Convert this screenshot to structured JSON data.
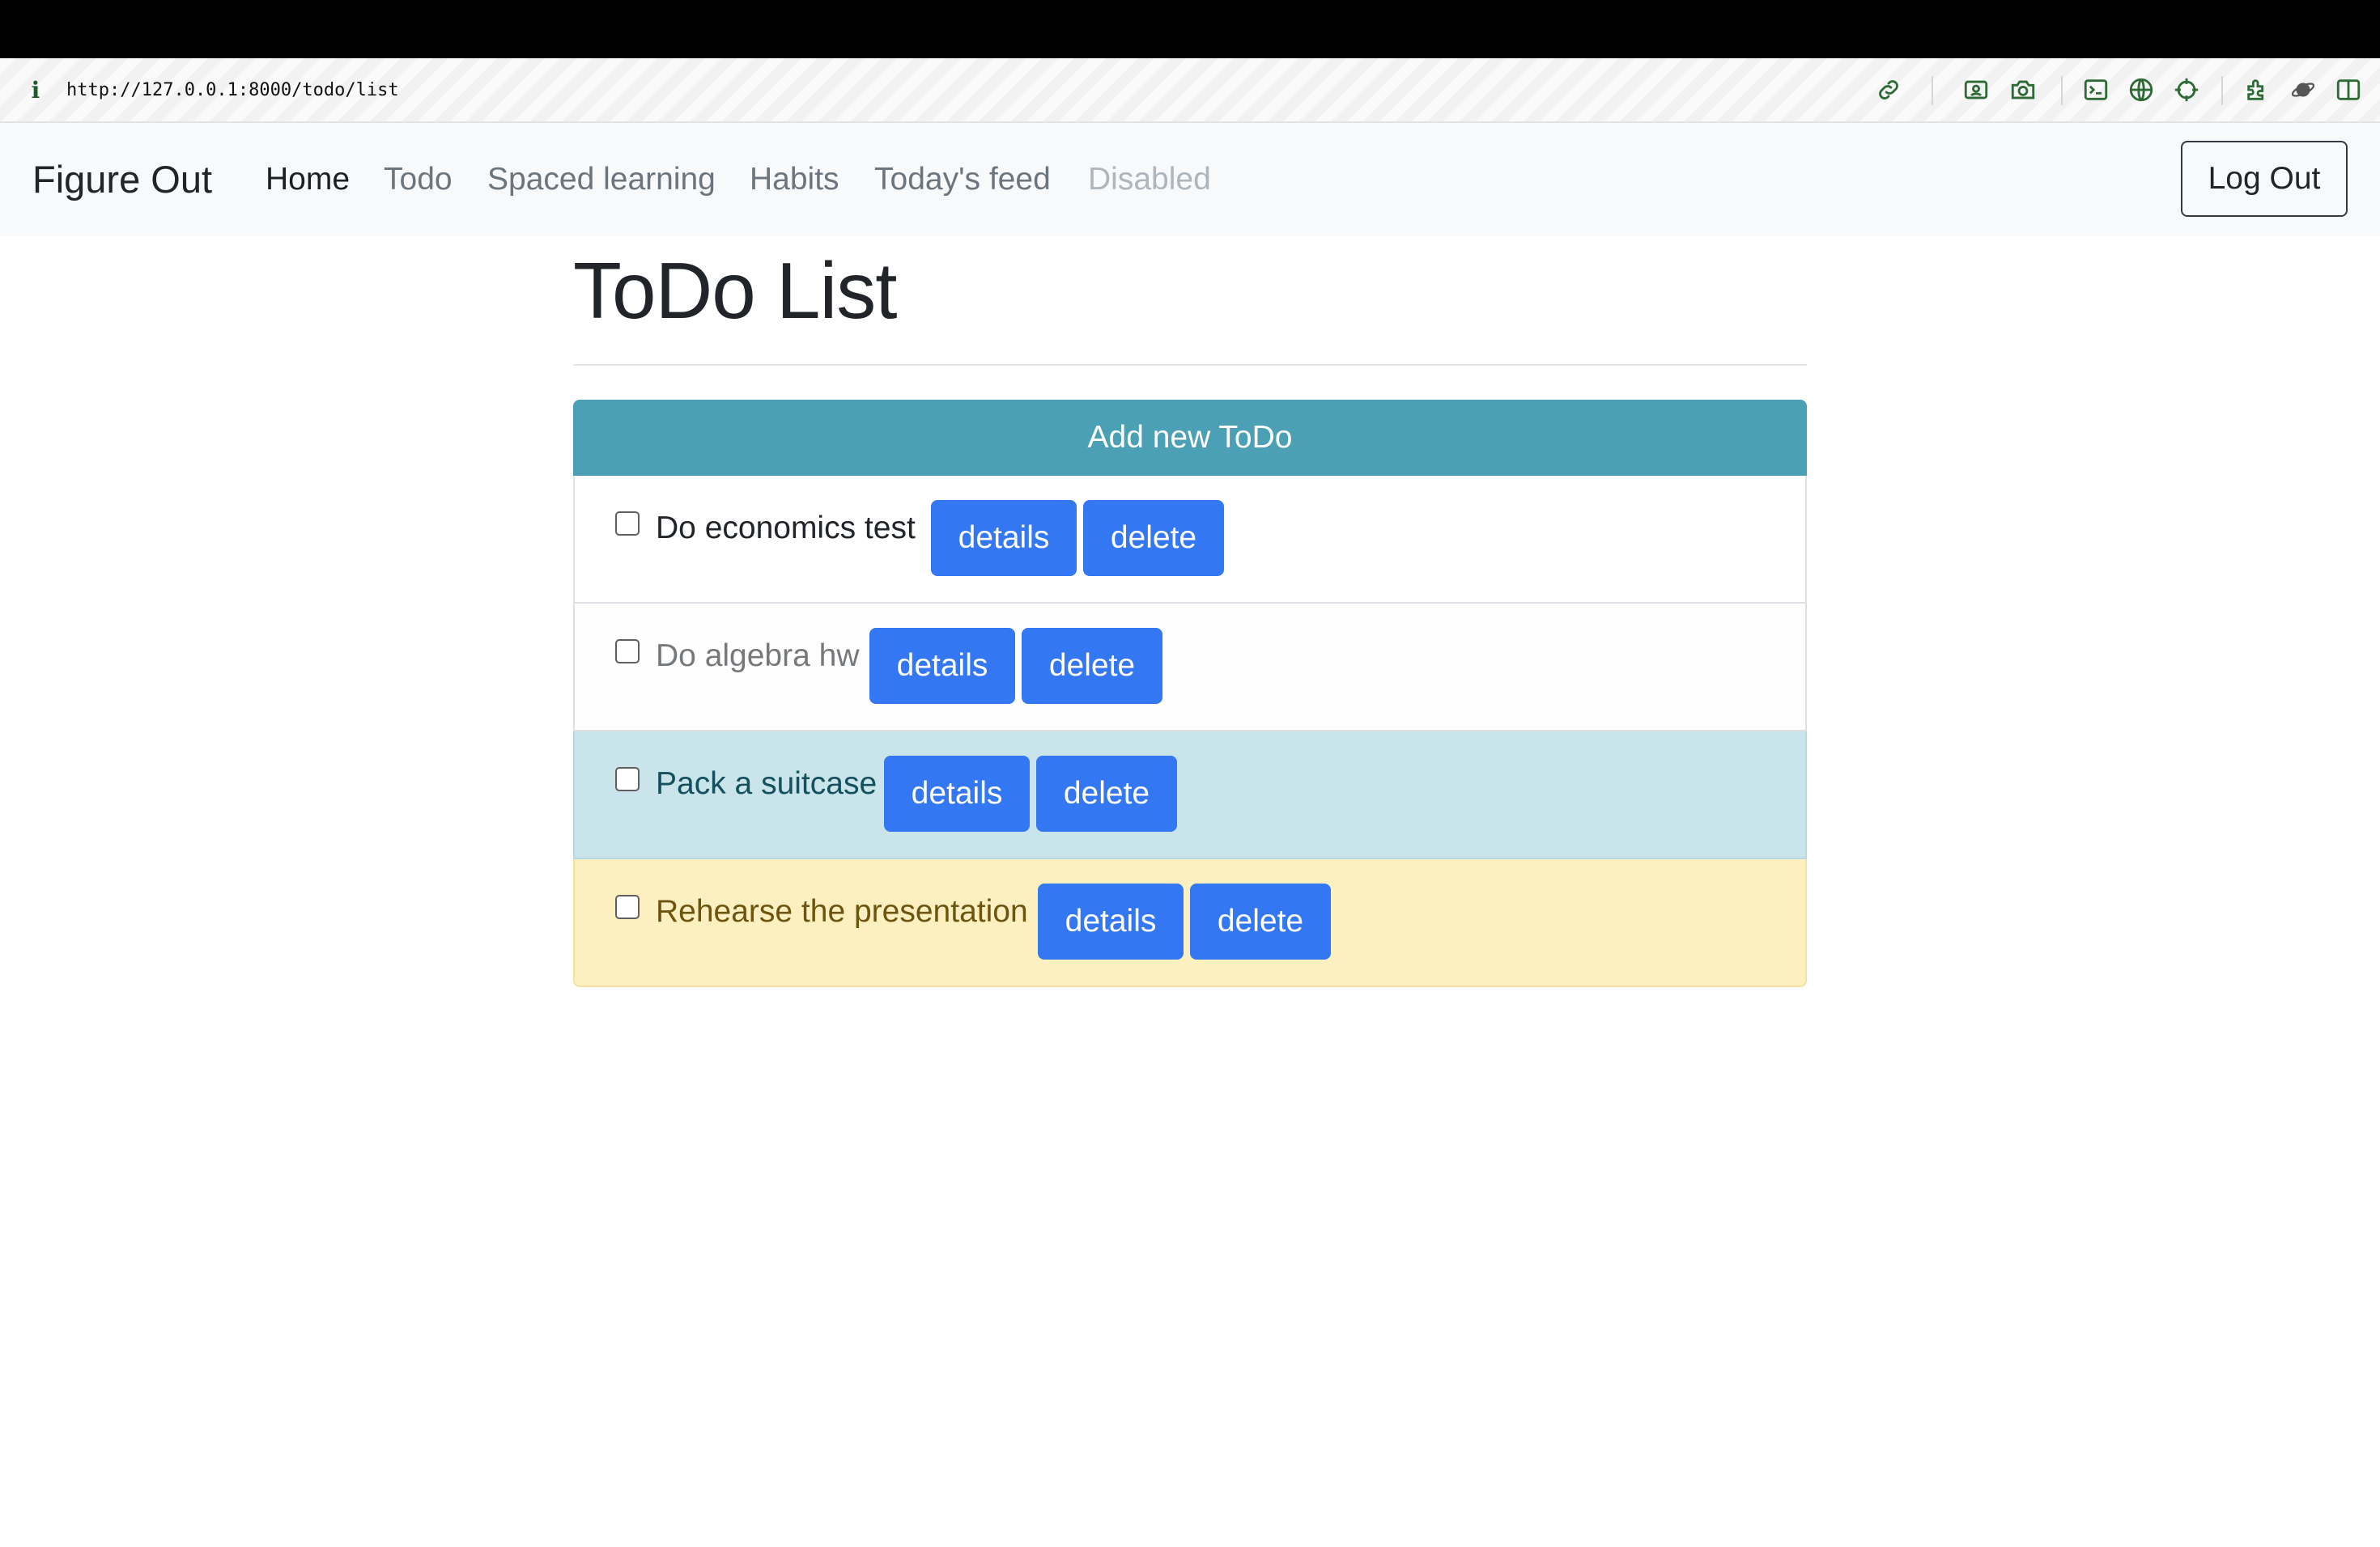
{
  "browser": {
    "info_icon": "i",
    "url": "http://127.0.0.1:8000/todo/list",
    "toolbar_icons": [
      "link-icon",
      "screenshot-icon",
      "camera-icon",
      "terminal-icon",
      "globe-icon",
      "crosshair-icon",
      "extensions-icon",
      "planet-icon",
      "split-view-icon"
    ]
  },
  "navbar": {
    "brand": "Figure Out",
    "links": [
      {
        "label": "Home",
        "state": "active"
      },
      {
        "label": "Todo",
        "state": "normal"
      },
      {
        "label": "Spaced learning",
        "state": "normal"
      },
      {
        "label": "Habits",
        "state": "normal"
      },
      {
        "label": "Today's feed",
        "state": "normal"
      },
      {
        "label": "Disabled",
        "state": "disabled"
      }
    ],
    "logout_label": "Log Out"
  },
  "page": {
    "title": "ToDo List",
    "add_button_label": "Add new ToDo"
  },
  "todos": [
    {
      "text": "Do economics test",
      "variant": "default",
      "checked": false,
      "details_label": "details",
      "delete_label": "delete"
    },
    {
      "text": "Do algebra hw",
      "variant": "light",
      "checked": false,
      "details_label": "details",
      "delete_label": "delete"
    },
    {
      "text": "Pack a suitcase",
      "variant": "info",
      "checked": false,
      "details_label": "details",
      "delete_label": "delete"
    },
    {
      "text": "Rehearse the presentation",
      "variant": "warning",
      "checked": false,
      "details_label": "details",
      "delete_label": "delete"
    }
  ],
  "colors": {
    "accent_button": "#3378f2",
    "add_button": "#4ba0b6",
    "info_row": "#c9e4ea",
    "warning_row": "#fcefc0"
  }
}
